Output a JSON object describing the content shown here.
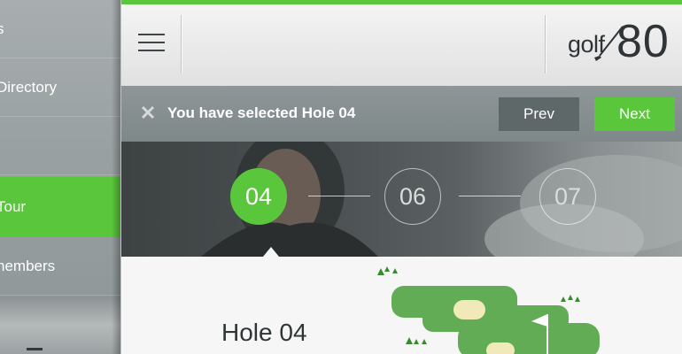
{
  "drawer": {
    "items": [
      {
        "label": "s"
      },
      {
        "label": "Directory"
      },
      {
        "label": ""
      },
      {
        "label": "Tour"
      },
      {
        "label": "nembers"
      }
    ]
  },
  "header": {
    "logo_prefix": "golf",
    "logo_number": "80"
  },
  "notice": {
    "message": "You have selected Hole 04",
    "prev_label": "Prev",
    "next_label": "Next"
  },
  "steps": [
    {
      "label": "04",
      "active": true
    },
    {
      "label": "06",
      "active": false
    },
    {
      "label": "07",
      "active": false
    }
  ],
  "hole": {
    "title": "Hole 04"
  },
  "colors": {
    "accent": "#5ac63b",
    "prev_button": "#5e6869",
    "notice_bar": "#858e8f",
    "text_dark": "#2f3536",
    "fairway": "#62ac55",
    "bunker": "#f1eab8"
  },
  "icons": {
    "menu": "hamburger-icon",
    "close": "close-icon",
    "flag": "flag-icon",
    "trees": "tree-icon"
  }
}
